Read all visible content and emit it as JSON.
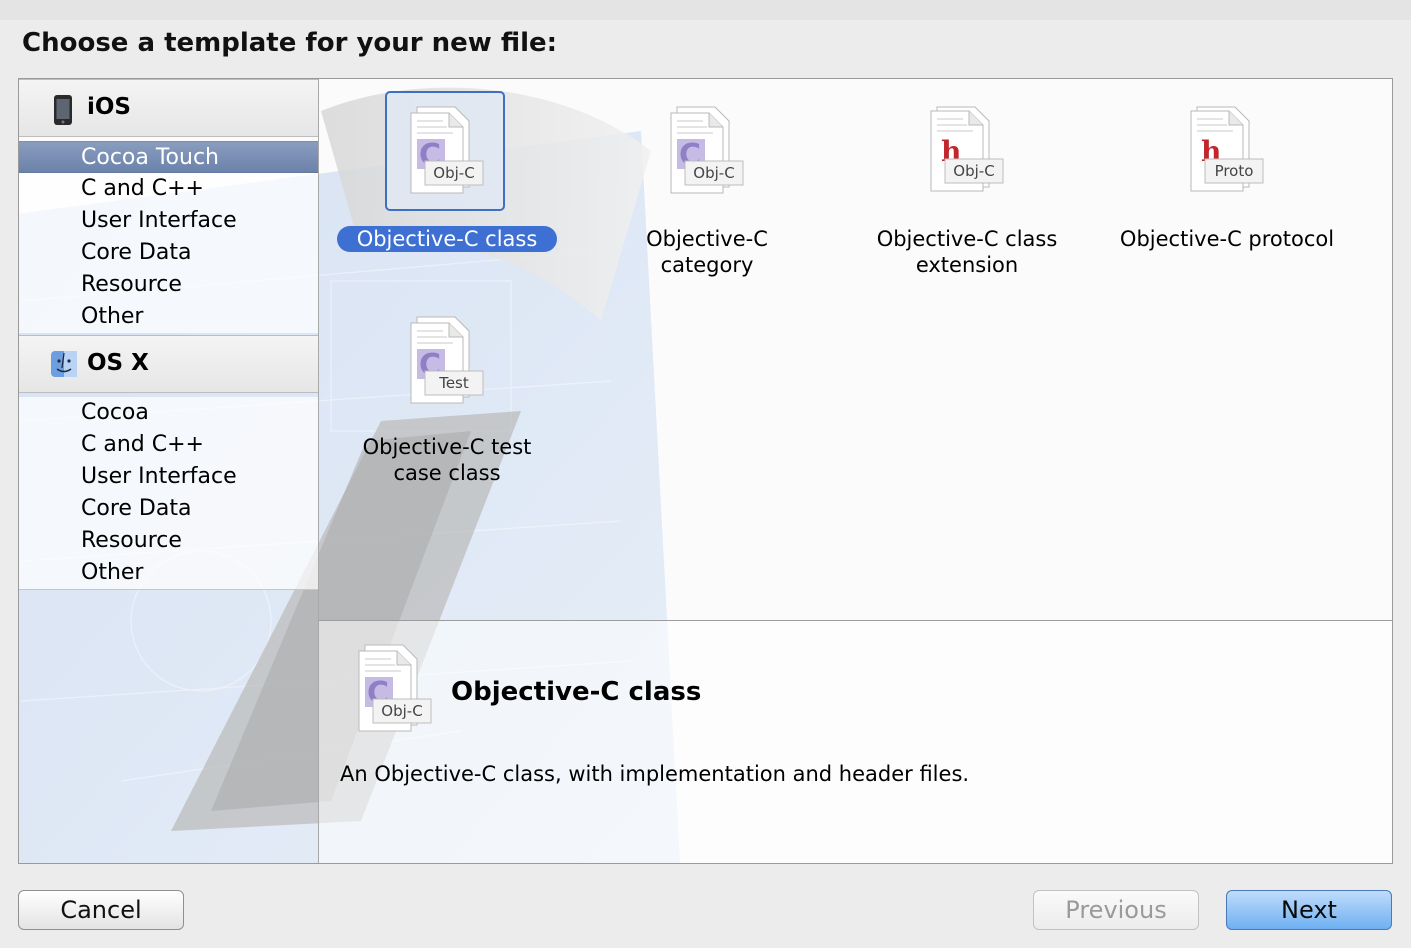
{
  "dialog": {
    "title": "Choose a template for your new file:"
  },
  "sidebar": {
    "sections": [
      {
        "name": "iOS",
        "icon": "iphone-icon",
        "items": [
          "Cocoa Touch",
          "C and C++",
          "User Interface",
          "Core Data",
          "Resource",
          "Other"
        ],
        "selected": "Cocoa Touch"
      },
      {
        "name": "OS X",
        "icon": "finder-icon",
        "items": [
          "Cocoa",
          "C and C++",
          "User Interface",
          "Core Data",
          "Resource",
          "Other"
        ]
      }
    ]
  },
  "templates": [
    {
      "label": "Objective-C class",
      "badge": "Obj-C",
      "glyph": "C",
      "icon": "objc-class-file-icon",
      "selected": true
    },
    {
      "label_line1": "Objective-C",
      "label_line2": "category",
      "badge": "Obj-C",
      "glyph": "C",
      "icon": "objc-category-file-icon"
    },
    {
      "label_line1": "Objective-C class",
      "label_line2": "extension",
      "badge": "Obj-C",
      "glyph": "h",
      "icon": "objc-extension-file-icon"
    },
    {
      "label": "Objective-C protocol",
      "badge": "Proto",
      "glyph": "h",
      "icon": "objc-protocol-file-icon"
    },
    {
      "label_line1": "Objective-C test",
      "label_line2": "case class",
      "badge": "Test",
      "glyph": "C",
      "icon": "objc-test-file-icon"
    }
  ],
  "detail": {
    "title": "Objective-C class",
    "badge": "Obj-C",
    "glyph": "C",
    "description": "An Objective-C class, with implementation and header files."
  },
  "buttons": {
    "cancel": "Cancel",
    "previous": "Previous",
    "next": "Next"
  },
  "colors": {
    "selection_blue": "#3e6fd2",
    "sidebar_selection": "#7a8fb3",
    "class_glyph": "#8f7fc4",
    "header_glyph": "#c0262b"
  }
}
